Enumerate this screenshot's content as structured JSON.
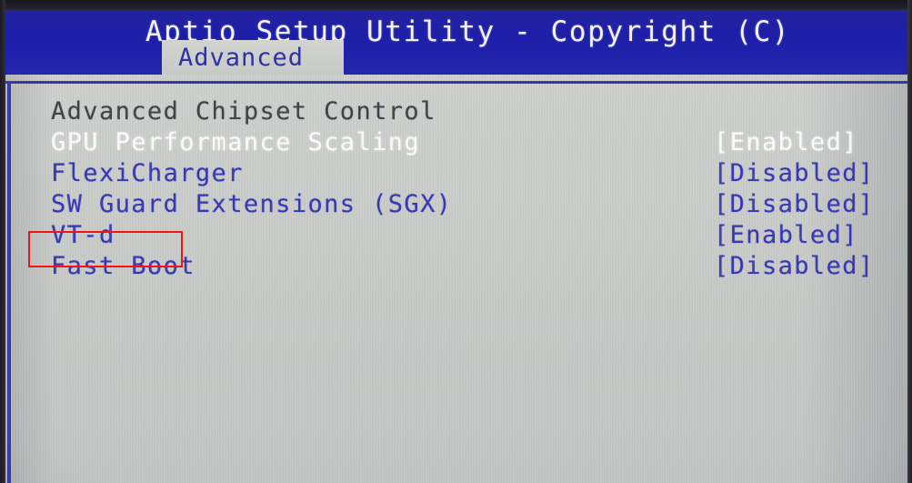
{
  "window": {
    "title": "Aptio Setup Utility - Copyright (C)",
    "header_bg": "#1f20a4",
    "screen_bg": "#c9ccc9"
  },
  "tabs": [
    {
      "label": "Advanced",
      "selected": true
    }
  ],
  "menu": {
    "rows": [
      {
        "label": "Advanced Chipset Control",
        "value": "",
        "state": "submenu"
      },
      {
        "label": "GPU Performance Scaling",
        "value": "[Enabled]",
        "state": "selected"
      },
      {
        "label": "FlexiCharger",
        "value": "[Disabled]",
        "state": "normal"
      },
      {
        "label": "SW Guard Extensions (SGX)",
        "value": "[Disabled]",
        "state": "normal"
      },
      {
        "label": "VT-d",
        "value": "[Enabled]",
        "state": "normal"
      },
      {
        "label": "Fast Boot",
        "value": "[Disabled]",
        "state": "normal"
      }
    ]
  },
  "annotation": {
    "target_label": "VT-d",
    "color": "#f01414"
  }
}
